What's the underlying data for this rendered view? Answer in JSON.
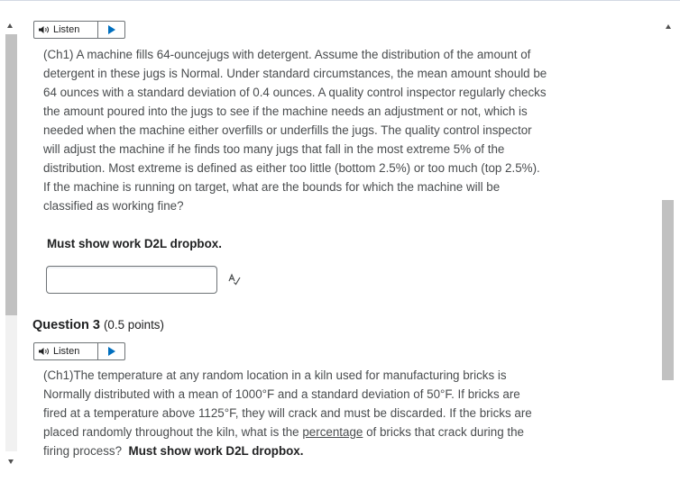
{
  "listen_label": "Listen",
  "question2": {
    "text": "(Ch1) A machine fills 64-ouncejugs with detergent. Assume the distribution of the amount of detergent in these jugs is Normal. Under standard circumstances, the mean amount should be 64 ounces with a standard deviation of 0.4 ounces. A quality control inspector regularly checks the amount poured into the jugs to see if the machine needs an adjustment or not, which is needed when the machine either overfills or underfills the jugs. The quality control inspector will adjust the machine if he finds too many jugs that fall in the most extreme 5% of the distribution. Most extreme is defined as either too little (bottom 2.5%) or too much (top 2.5%). If the machine is running on target, what are the bounds for which the machine will be classified as working fine?",
    "instruction": "Must show work D2L dropbox.",
    "answer_value": ""
  },
  "question3": {
    "title": "Question 3",
    "points": "(0.5 points)",
    "text_part1": "(Ch1)The temperature at any random location in a kiln used for manufacturing bricks is Normally distributed with a mean of 1000°F and a standard deviation of 50°F. If bricks are fired at a temperature above 1125°F, they will crack and must be discarded. If the bricks are placed randomly throughout the kiln, what is the",
    "link_text": "percentage",
    "text_part2": "of bricks that crack during the firing process?",
    "instruction": "Must show work D2L dropbox."
  },
  "icons": [
    "speaker-icon",
    "play-icon",
    "spellcheck-icon",
    "scroll-up-icon",
    "scroll-down-icon"
  ]
}
